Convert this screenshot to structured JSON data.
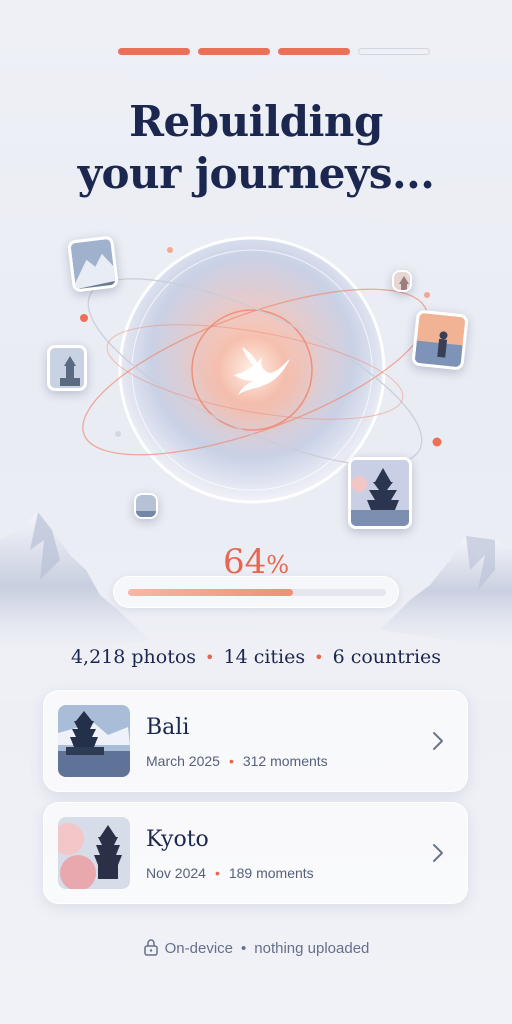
{
  "progress_steps": {
    "total": 4,
    "completed": 3
  },
  "title": {
    "line1": "Rebuilding",
    "line2": "your journeys..."
  },
  "progress": {
    "value": "64",
    "symbol": "%",
    "fraction": 0.64
  },
  "stats": {
    "photos": "4,218 photos",
    "cities": "14 cities",
    "countries": "6 countries",
    "separator": "•"
  },
  "trips": [
    {
      "name": "Bali",
      "date": "March 2025",
      "moments": "312 moments",
      "icon": "chevron-right-icon"
    },
    {
      "name": "Kyoto",
      "date": "Nov 2024",
      "moments": "189 moments",
      "icon": "chevron-right-icon"
    }
  ],
  "footer": {
    "left": "On-device",
    "separator": "•",
    "right": "nothing uploaded",
    "icon": "lock-icon"
  },
  "colors": {
    "accent": "#e8654e",
    "navy": "#1c2750",
    "muted": "#56617c"
  }
}
